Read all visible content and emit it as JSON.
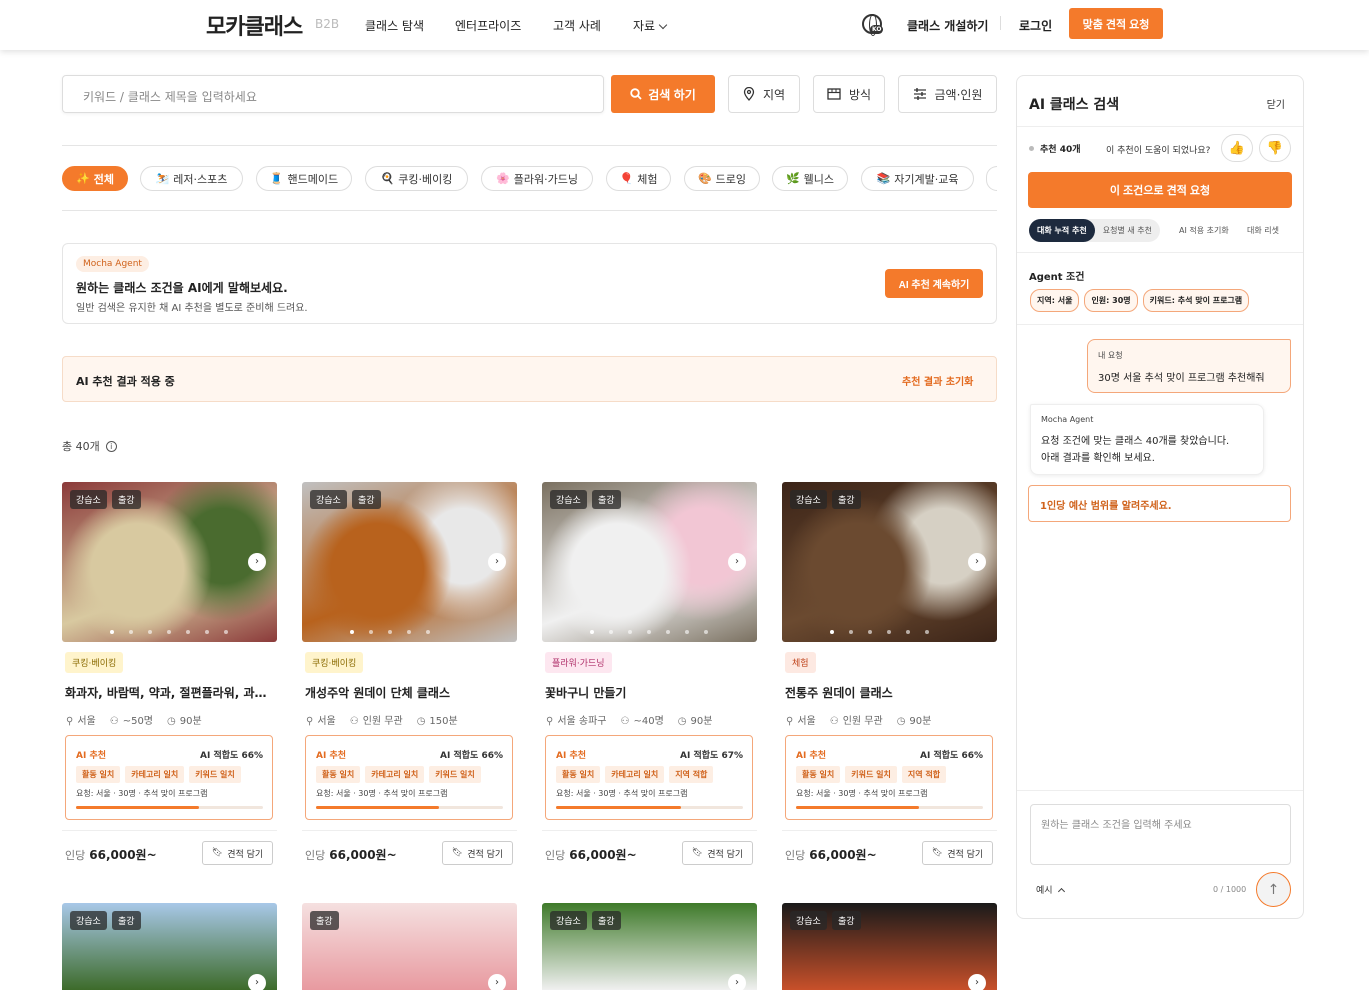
{
  "header": {
    "logo": "모카클래스",
    "logo_sub": "B2B",
    "nav": [
      "클래스 탐색",
      "엔터프라이즈",
      "고객 사례",
      "자료"
    ],
    "lang_badge": "KO",
    "open_class": "클래스 개설하기",
    "login": "로그인",
    "quote_cta": "맞춤 견적 요청"
  },
  "search": {
    "placeholder": "키워드 / 클래스 제목을 입력하세요",
    "button": "검색 하기",
    "filters": [
      "지역",
      "방식",
      "금액·인원"
    ]
  },
  "categories": [
    {
      "emoji": "✨",
      "label": "전체",
      "active": true
    },
    {
      "emoji": "⛷️",
      "label": "레저·스포츠"
    },
    {
      "emoji": "🧵",
      "label": "핸드메이드"
    },
    {
      "emoji": "🍳",
      "label": "쿠킹·베이킹"
    },
    {
      "emoji": "🌸",
      "label": "플라워·가드닝"
    },
    {
      "emoji": "🎈",
      "label": "체험"
    },
    {
      "emoji": "🎨",
      "label": "드로잉"
    },
    {
      "emoji": "🌿",
      "label": "웰니스"
    },
    {
      "emoji": "📚",
      "label": "자기계발·교육"
    }
  ],
  "agent_banner": {
    "badge": "Mocha Agent",
    "title": "원하는 클래스 조건을 AI에게 말해보세요.",
    "desc": "일반 검색은 유지한 채 AI 추천을 별도로 준비해 드려요.",
    "cta": "AI 추천 계속하기"
  },
  "applied": {
    "text": "AI 추천 결과 적용 중",
    "reset": "추천 결과 초기화"
  },
  "total": "총 40개",
  "colors": {
    "accent": "#f47a2b",
    "accent_light": "#fff6ef"
  },
  "cards": [
    {
      "tags": [
        "강습소",
        "출강"
      ],
      "dots": 7,
      "active_dot": 0,
      "category": "쿠킹·베이킹",
      "cat_bg": "#fff4cc",
      "cat_fg": "#8a6a00",
      "title": "화과자, 바람떡, 약과, 절편플라워, 과일찹쌀떡 만들기",
      "location": "서울",
      "people": "~50명",
      "duration": "90분",
      "ai_label": "AI 추천",
      "ai_score": "AI 적합도 66%",
      "score": 0.66,
      "ai_chips": [
        "활동 일치",
        "카테고리 일치",
        "키워드 일치"
      ],
      "ai_req": "요청: 서울 · 30명 · 추석 맞이 프로그램",
      "price_unit": "인당",
      "price": "66,000원~",
      "save": "견적 담기",
      "palette": [
        "#8b3a3a",
        "#d8c9a0",
        "#4a6b2f"
      ]
    },
    {
      "tags": [
        "강습소",
        "출강"
      ],
      "dots": 5,
      "active_dot": 0,
      "category": "쿠킹·베이킹",
      "cat_bg": "#fff4cc",
      "cat_fg": "#8a6a00",
      "title": "개성주악 원데이 단체 클래스",
      "location": "서울",
      "people": "인원 무관",
      "duration": "150분",
      "ai_label": "AI 추천",
      "ai_score": "AI 적합도 66%",
      "score": 0.66,
      "ai_chips": [
        "활동 일치",
        "카테고리 일치",
        "키워드 일치"
      ],
      "ai_req": "요청: 서울 · 30명 · 추석 맞이 프로그램",
      "price_unit": "인당",
      "price": "66,000원~",
      "save": "견적 담기",
      "palette": [
        "#c0c0c0",
        "#b8621d",
        "#e8e8e8"
      ]
    },
    {
      "tags": [
        "강습소",
        "출강"
      ],
      "dots": 7,
      "active_dot": 0,
      "category": "플라워·가드닝",
      "cat_bg": "#fde7f0",
      "cat_fg": "#b0306a",
      "title": "꽃바구니 만들기",
      "location": "서울 송파구",
      "people": "~40명",
      "duration": "90분",
      "ai_label": "AI 추천",
      "ai_score": "AI 적합도 67%",
      "score": 0.67,
      "ai_chips": [
        "활동 일치",
        "카테고리 일치",
        "지역 적합"
      ],
      "ai_req": "요청: 서울 · 30명 · 추석 맞이 프로그램",
      "price_unit": "인당",
      "price": "66,000원~",
      "save": "견적 담기",
      "palette": [
        "#7a7060",
        "#f0f0f0",
        "#f2c6d4"
      ]
    },
    {
      "tags": [
        "강습소",
        "출강"
      ],
      "dots": 6,
      "active_dot": 0,
      "category": "체험",
      "cat_bg": "#fde9e2",
      "cat_fg": "#c0461f",
      "title": "전통주 원데이 클래스",
      "location": "서울",
      "people": "인원 무관",
      "duration": "90분",
      "ai_label": "AI 추천",
      "ai_score": "AI 적합도 66%",
      "score": 0.66,
      "ai_chips": [
        "활동 일치",
        "키워드 일치",
        "지역 적합"
      ],
      "ai_req": "요청: 서울 · 30명 · 추석 맞이 프로그램",
      "price_unit": "인당",
      "price": "66,000원~",
      "save": "견적 담기",
      "palette": [
        "#3b2418",
        "#6b4a30",
        "#d6d0c4"
      ]
    }
  ],
  "cards_row2": [
    {
      "tags": [
        "강습소",
        "출강"
      ],
      "palette": [
        "#a8c8e8",
        "#3d6b2a"
      ]
    },
    {
      "tags": [
        "출강"
      ],
      "palette": [
        "#f5e0e0",
        "#e89aa0"
      ]
    },
    {
      "tags": [
        "강습소",
        "출강"
      ],
      "palette": [
        "#3f7a2a",
        "#f0f0f0"
      ]
    },
    {
      "tags": [
        "강습소",
        "출강"
      ],
      "palette": [
        "#1a1a1a",
        "#c8502a"
      ]
    }
  ],
  "panel": {
    "title": "AI 클래스 검색",
    "close": "닫기",
    "rec_count": "추천 40개",
    "helpful": "이 추천이 도움이 되었나요?",
    "cta": "이 조건으로 견적 요청",
    "seg": [
      "대화 누적 추천",
      "요청별 새 추천"
    ],
    "links": [
      "AI 적용 초기화",
      "대화 리셋"
    ],
    "cond_label": "Agent 조건",
    "conds": [
      "지역: 서울",
      "인원: 30명",
      "키워드: 추석 맞이 프로그램"
    ],
    "user_label": "내 요청",
    "user_msg": "30명 서울 추석 맞이 프로그램 추천해줘",
    "agent_label": "Mocha Agent",
    "agent_msg_1": "요청 조건에 맞는 클래스 40개를 찾았습니다.",
    "agent_msg_2": "아래 결과를 확인해 보세요.",
    "question": "1인당 예산 범위를 알려주세요.",
    "input_placeholder": "원하는 클래스 조건을 입력해 주세요",
    "examples": "예시",
    "count": "0 / 1000"
  }
}
